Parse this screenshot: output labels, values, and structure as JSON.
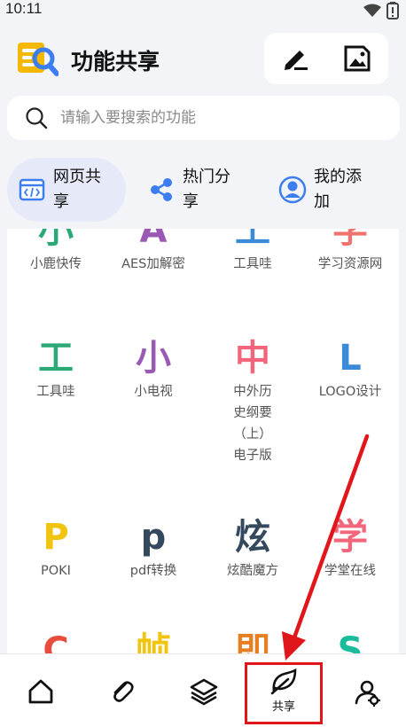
{
  "status_bar": {
    "time": "10:11"
  },
  "header": {
    "title": "功能共享",
    "edit_icon": "pencil-icon",
    "image_icon": "image-icon"
  },
  "search": {
    "placeholder": "请输入要搜索的功能"
  },
  "categories": [
    {
      "label": "网页共享",
      "icon": "webpage-code-icon",
      "active": true
    },
    {
      "label": "热门分享",
      "icon": "share-icon",
      "active": false
    },
    {
      "label": "我的添加",
      "icon": "user-circle-icon",
      "active": false
    }
  ],
  "grid": [
    {
      "glyph": "小",
      "color": "#2aa876",
      "label": "小鹿快传"
    },
    {
      "glyph": "A",
      "color": "#9b59b6",
      "label": "AES加解密"
    },
    {
      "glyph": "工",
      "color": "#3b8ad9",
      "label": "工具哇"
    },
    {
      "glyph": "学",
      "color": "#f0726e",
      "label": "学习资源网"
    },
    {
      "glyph": "工",
      "color": "#2aa876",
      "label": "工具哇"
    },
    {
      "glyph": "小",
      "color": "#9b59b6",
      "label": "小电视"
    },
    {
      "glyph": "中",
      "color": "#f2657a",
      "label": "中外历史纲要（上）电子版"
    },
    {
      "glyph": "L",
      "color": "#3b8ad9",
      "label": "LOGO设计"
    },
    {
      "glyph": "P",
      "color": "#f1c40f",
      "label": "POKI"
    },
    {
      "glyph": "p",
      "color": "#34495e",
      "label": "pdf转换"
    },
    {
      "glyph": "炫",
      "color": "#34495e",
      "label": "炫酷魔方"
    },
    {
      "glyph": "学",
      "color": "#f2657a",
      "label": "学堂在线"
    },
    {
      "glyph": "C",
      "color": "#e74c3c",
      "label": ""
    },
    {
      "glyph": "帧",
      "color": "#f1c40f",
      "label": ""
    },
    {
      "glyph": "即",
      "color": "#e67e22",
      "label": ""
    },
    {
      "glyph": "S",
      "color": "#1abc9c",
      "label": ""
    }
  ],
  "bottom_nav": [
    {
      "icon": "home-icon",
      "label": ""
    },
    {
      "icon": "paperclip-icon",
      "label": ""
    },
    {
      "icon": "layers-icon",
      "label": ""
    },
    {
      "icon": "leaf-icon",
      "label": "共享"
    },
    {
      "icon": "profile-gear-icon",
      "label": ""
    }
  ],
  "colors": {
    "accent_tab_bg": "#e5e9f8",
    "annotation_red": "#e0161b",
    "logo_yellow": "#f5b800",
    "logo_blue": "#3c7df0"
  }
}
